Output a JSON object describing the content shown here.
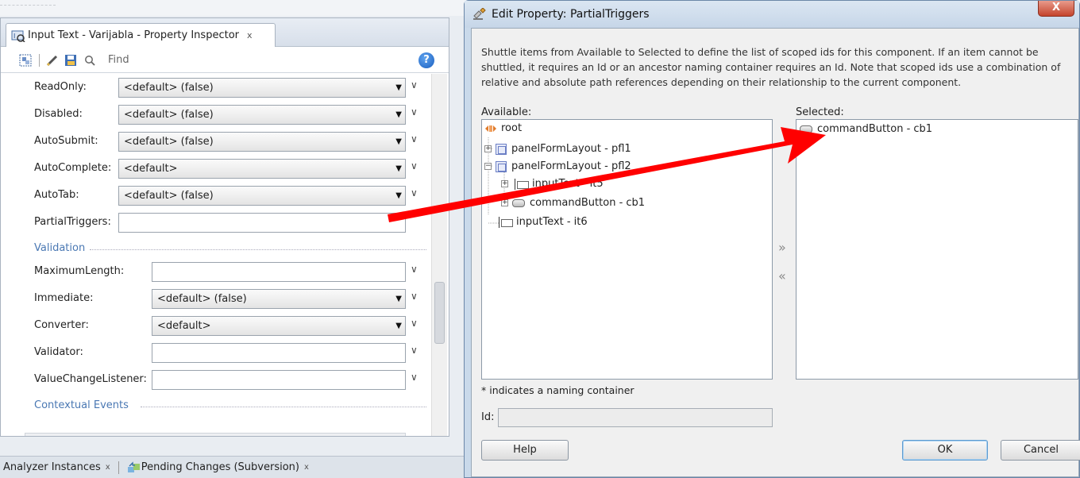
{
  "inspector": {
    "tab_title": "Input Text - Varijabla - Property Inspector",
    "tab_close": "x",
    "find_placeholder": "Find",
    "help_glyph": "?",
    "properties": [
      {
        "label": "ReadOnly:",
        "type": "combo",
        "value": "<default> (false)"
      },
      {
        "label": "Disabled:",
        "type": "combo",
        "value": "<default> (false)"
      },
      {
        "label": "AutoSubmit:",
        "type": "combo",
        "value": "<default> (false)"
      },
      {
        "label": "AutoComplete:",
        "type": "combo",
        "value": "<default>"
      },
      {
        "label": "AutoTab:",
        "type": "combo",
        "value": "<default> (false)"
      },
      {
        "label": "PartialTriggers:",
        "type": "text",
        "value": ""
      }
    ],
    "validation_section": "Validation",
    "validation_properties": [
      {
        "label": "MaximumLength:",
        "type": "text",
        "value": ""
      },
      {
        "label": "Immediate:",
        "type": "combo",
        "value": "<default> (false)"
      },
      {
        "label": "Converter:",
        "type": "combo",
        "value": "<default>"
      },
      {
        "label": "Validator:",
        "type": "text",
        "value": ""
      },
      {
        "label": "ValueChangeListener:",
        "type": "text",
        "value": ""
      }
    ],
    "events_section": "Contextual Events"
  },
  "bottom_tabs": [
    {
      "label": "Analyzer Instances",
      "close": "x"
    },
    {
      "label": "Pending Changes (Subversion)",
      "close": "x"
    }
  ],
  "dialog": {
    "title": "Edit Property: PartialTriggers",
    "close_glyph": "X",
    "description": "Shuttle items from Available to Selected to define the list of scoped ids for this component. If an item cannot be shuttled, it requires an Id or an ancestor naming container requires an Id. Note that scoped ids use a combination of relative and absolute path references depending on their relationship to the current component.",
    "available_label": "Available:",
    "selected_label": "Selected:",
    "tree": {
      "root": "root",
      "pfl1": "panelFormLayout - pfl1",
      "pfl2": "panelFormLayout - pfl2",
      "input_child": "inputText - it5",
      "button_child": "commandButton - cb1",
      "it6": "inputText - it6"
    },
    "selected_items": [
      "commandButton - cb1"
    ],
    "shuttle_right": "»",
    "shuttle_left": "«",
    "footnote": "* indicates a naming container",
    "id_label": "Id:",
    "help_button": "Help",
    "ok_button": "OK",
    "cancel_button": "Cancel"
  },
  "colors": {
    "annotation_arrow": "#ff0000",
    "section_label": "#4a78b3",
    "dialog_frame": "#c9d9ea"
  }
}
